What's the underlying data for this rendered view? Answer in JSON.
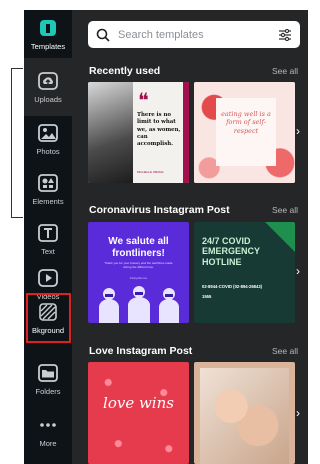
{
  "rail": {
    "logo_label": "Templates",
    "items": [
      {
        "label": "Uploads",
        "icon": "upload-cloud-icon"
      },
      {
        "label": "Photos",
        "icon": "image-icon"
      },
      {
        "label": "Elements",
        "icon": "shapes-icon"
      },
      {
        "label": "Text",
        "icon": "text-t-icon"
      },
      {
        "label": "Videos",
        "icon": "play-icon"
      },
      {
        "label": "Bkground",
        "icon": "background-hatch-icon"
      },
      {
        "label": "Folders",
        "icon": "folder-icon"
      },
      {
        "label": "More",
        "icon": "more-dots-icon"
      }
    ]
  },
  "search": {
    "placeholder": "Search templates"
  },
  "sections": [
    {
      "title": "Recently used",
      "see_all": "See all",
      "tiles": [
        {
          "quote": "There is no limit to what we, as women, can accomplish.",
          "author": "MICHELLE OBAMA"
        },
        {
          "script": "eating well is a form of self-respect"
        }
      ]
    },
    {
      "title": "Coronavirus Instagram Post",
      "see_all": "See all",
      "tiles": [
        {
          "headline": "We salute all frontliners!",
          "sub": "Thank you for your bravery and the sacrifices made during the difficult time.",
          "tag": "#stayathome"
        },
        {
          "headline": "24/7 COVID EMERGENCY HOTLINE",
          "line1": "02-8944-COVID (02-894-26843)",
          "line2": "1555"
        }
      ]
    },
    {
      "title": "Love Instagram Post",
      "see_all": "See all",
      "tiles": [
        {
          "script": "love wins"
        },
        {}
      ]
    }
  ],
  "colors": {
    "rail_bg": "#0e1318",
    "panel_bg": "#252627",
    "accent_red": "#e02020",
    "magenta": "#a3104e",
    "purple": "#5a2bd8",
    "green": "#1f8f4e"
  }
}
